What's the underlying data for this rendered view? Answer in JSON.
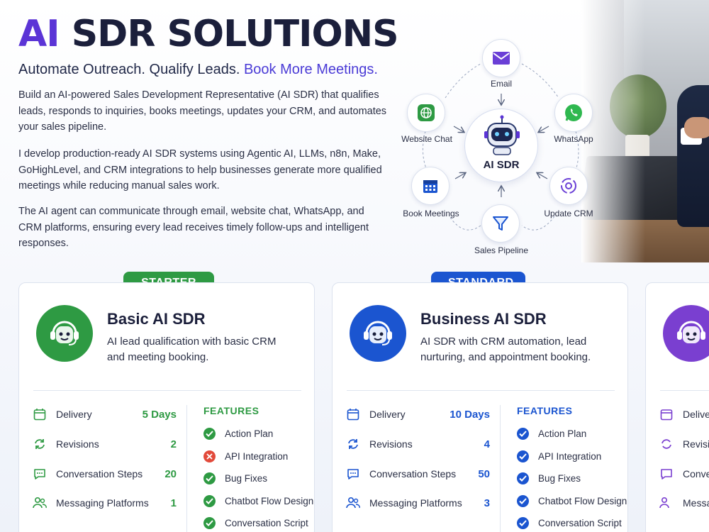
{
  "header": {
    "title_accent": "AI",
    "title_rest": "SDR SOLUTIONS",
    "subtitle_main": "Automate Outreach. Qualify Leads.",
    "subtitle_accent": "Book More Meetings.",
    "paragraphs": [
      "Build an AI-powered Sales Development Representative (AI SDR) that qualifies leads, responds to inquiries, books meetings, updates your CRM, and automates your sales pipeline.",
      "I develop production-ready AI SDR systems using Agentic AI, LLMs, n8n, Make, GoHighLevel, and CRM integrations to help businesses generate more qualified meetings while reducing manual sales work.",
      "The AI agent can communicate through email, website chat, WhatsApp, and CRM platforms, ensuring every lead receives timely follow-ups and intelligent responses."
    ]
  },
  "diagram": {
    "hub_label": "AI SDR",
    "hub_icon": "robot-icon",
    "nodes": [
      {
        "label": "Email",
        "icon": "envelope-icon",
        "color": "#6a3fd6"
      },
      {
        "label": "WhatsApp",
        "icon": "whatsapp-icon",
        "color": "#2fb84f"
      },
      {
        "label": "Update CRM",
        "icon": "crm-sync-icon",
        "color": "#6a3fd6"
      },
      {
        "label": "Sales Pipeline",
        "icon": "funnel-icon",
        "color": "#1b55d0"
      },
      {
        "label": "Book Meetings",
        "icon": "calendar-icon",
        "color": "#1b55d0"
      },
      {
        "label": "Website Chat",
        "icon": "globe-chat-icon",
        "color": "#2e9a43"
      }
    ]
  },
  "plans": [
    {
      "tier": "STARTER",
      "accent": "#2e9a43",
      "title": "Basic AI SDR",
      "description": "AI lead qualification with basic CRM and meeting booking.",
      "stats": [
        {
          "label": "Delivery",
          "value": "5 Days",
          "icon": "calendar-icon"
        },
        {
          "label": "Revisions",
          "value": "2",
          "icon": "refresh-icon"
        },
        {
          "label": "Conversation Steps",
          "value": "20",
          "icon": "chat-icon"
        },
        {
          "label": "Messaging Platforms",
          "value": "1",
          "icon": "users-icon"
        }
      ],
      "features_heading": "FEATURES",
      "features": [
        {
          "label": "Action Plan",
          "included": true
        },
        {
          "label": "API Integration",
          "included": false
        },
        {
          "label": "Bug Fixes",
          "included": true
        },
        {
          "label": "Chatbot Flow Design",
          "included": true
        },
        {
          "label": "Conversation Script",
          "included": true
        }
      ]
    },
    {
      "tier": "STANDARD",
      "accent": "#1b55d0",
      "title": "Business AI SDR",
      "description": "AI SDR with CRM automation, lead nurturing, and appointment booking.",
      "stats": [
        {
          "label": "Delivery",
          "value": "10 Days",
          "icon": "calendar-icon"
        },
        {
          "label": "Revisions",
          "value": "4",
          "icon": "refresh-icon"
        },
        {
          "label": "Conversation Steps",
          "value": "50",
          "icon": "chat-icon"
        },
        {
          "label": "Messaging Platforms",
          "value": "3",
          "icon": "users-icon"
        }
      ],
      "features_heading": "FEATURES",
      "features": [
        {
          "label": "Action Plan",
          "included": true
        },
        {
          "label": "API Integration",
          "included": true
        },
        {
          "label": "Bug Fixes",
          "included": true
        },
        {
          "label": "Chatbot Flow Design",
          "included": true
        },
        {
          "label": "Conversation Script",
          "included": true
        }
      ]
    },
    {
      "accent": "#7a3fd0",
      "stats": [
        {
          "label": "Delive",
          "icon": "calendar-icon"
        },
        {
          "label": "Revisio",
          "icon": "refresh-icon"
        },
        {
          "label": "Conve",
          "icon": "chat-icon"
        },
        {
          "label": "Messa",
          "icon": "users-icon"
        }
      ]
    }
  ]
}
